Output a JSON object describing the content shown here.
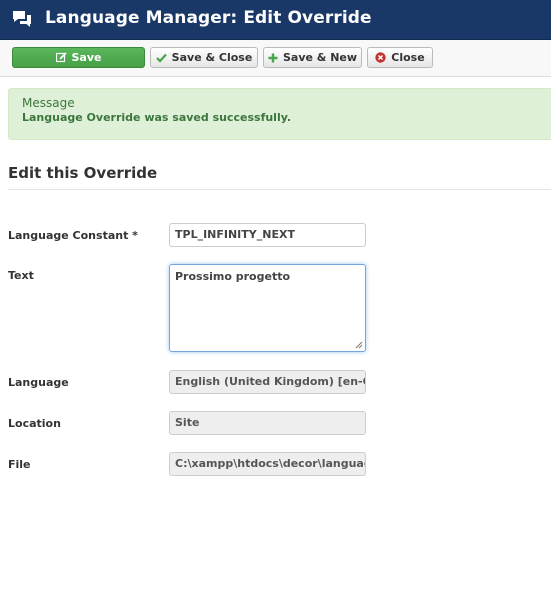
{
  "header": {
    "title": "Language Manager: Edit Override",
    "icon": "comments-icon"
  },
  "toolbar": {
    "save_label": "Save",
    "save_close_label": "Save & Close",
    "save_new_label": "Save & New",
    "close_label": "Close"
  },
  "alert": {
    "heading": "Message",
    "message": "Language Override was saved successfully."
  },
  "form": {
    "legend": "Edit this Override",
    "fields": {
      "constant": {
        "label": "Language Constant *",
        "value": "TPL_INFINITY_NEXT"
      },
      "text": {
        "label": "Text",
        "value": "Prossimo progetto"
      },
      "language": {
        "label": "Language",
        "value": "English (United Kingdom) [en-GB]"
      },
      "location": {
        "label": "Location",
        "value": "Site"
      },
      "file": {
        "label": "File",
        "value": "C:\\xampp\\htdocs\\decor\\language\\overrides\\en-GB.override.ini"
      }
    }
  },
  "colors": {
    "header_bg": "#1a3867",
    "save_button": "#5bb75b",
    "alert_bg": "#dff0d8",
    "alert_text": "#3c763d",
    "close_icon": "#bd362f"
  }
}
